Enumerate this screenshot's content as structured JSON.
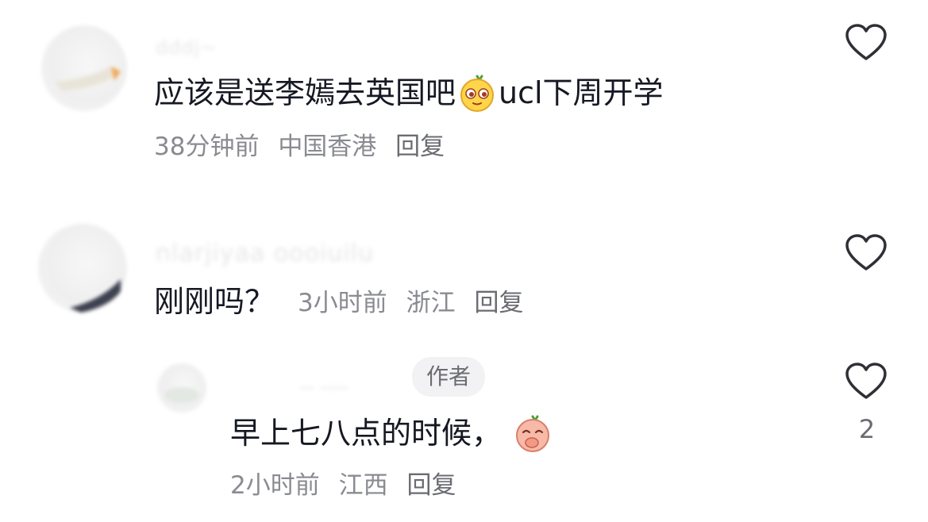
{
  "comments": [
    {
      "username": "dddj~",
      "text_before_emoji": "应该是送李嫣去英国吧",
      "emoji": "smug-face-sticker",
      "text_after_emoji": "ucl下周开学",
      "time": "38分钟前",
      "location": "中国香港",
      "reply_label": "回复"
    },
    {
      "username": "nlarjiyaa oooiuilu",
      "text": "刚刚吗？",
      "time": "3小时前",
      "location": "浙江",
      "reply_label": "回复"
    },
    {
      "username": "-- ----",
      "author_badge": "作者",
      "text": "早上七八点的时候，",
      "emoji": "covering-mouth-sticker",
      "time": "2小时前",
      "location": "江西",
      "reply_label": "回复",
      "like_count": "2"
    }
  ],
  "icons": {
    "like": "heart-outline-icon"
  },
  "colors": {
    "text_primary": "#161823",
    "text_meta": "#8a8b91",
    "badge_bg": "#f2f2f4",
    "icon_stroke": "#2f3036"
  }
}
